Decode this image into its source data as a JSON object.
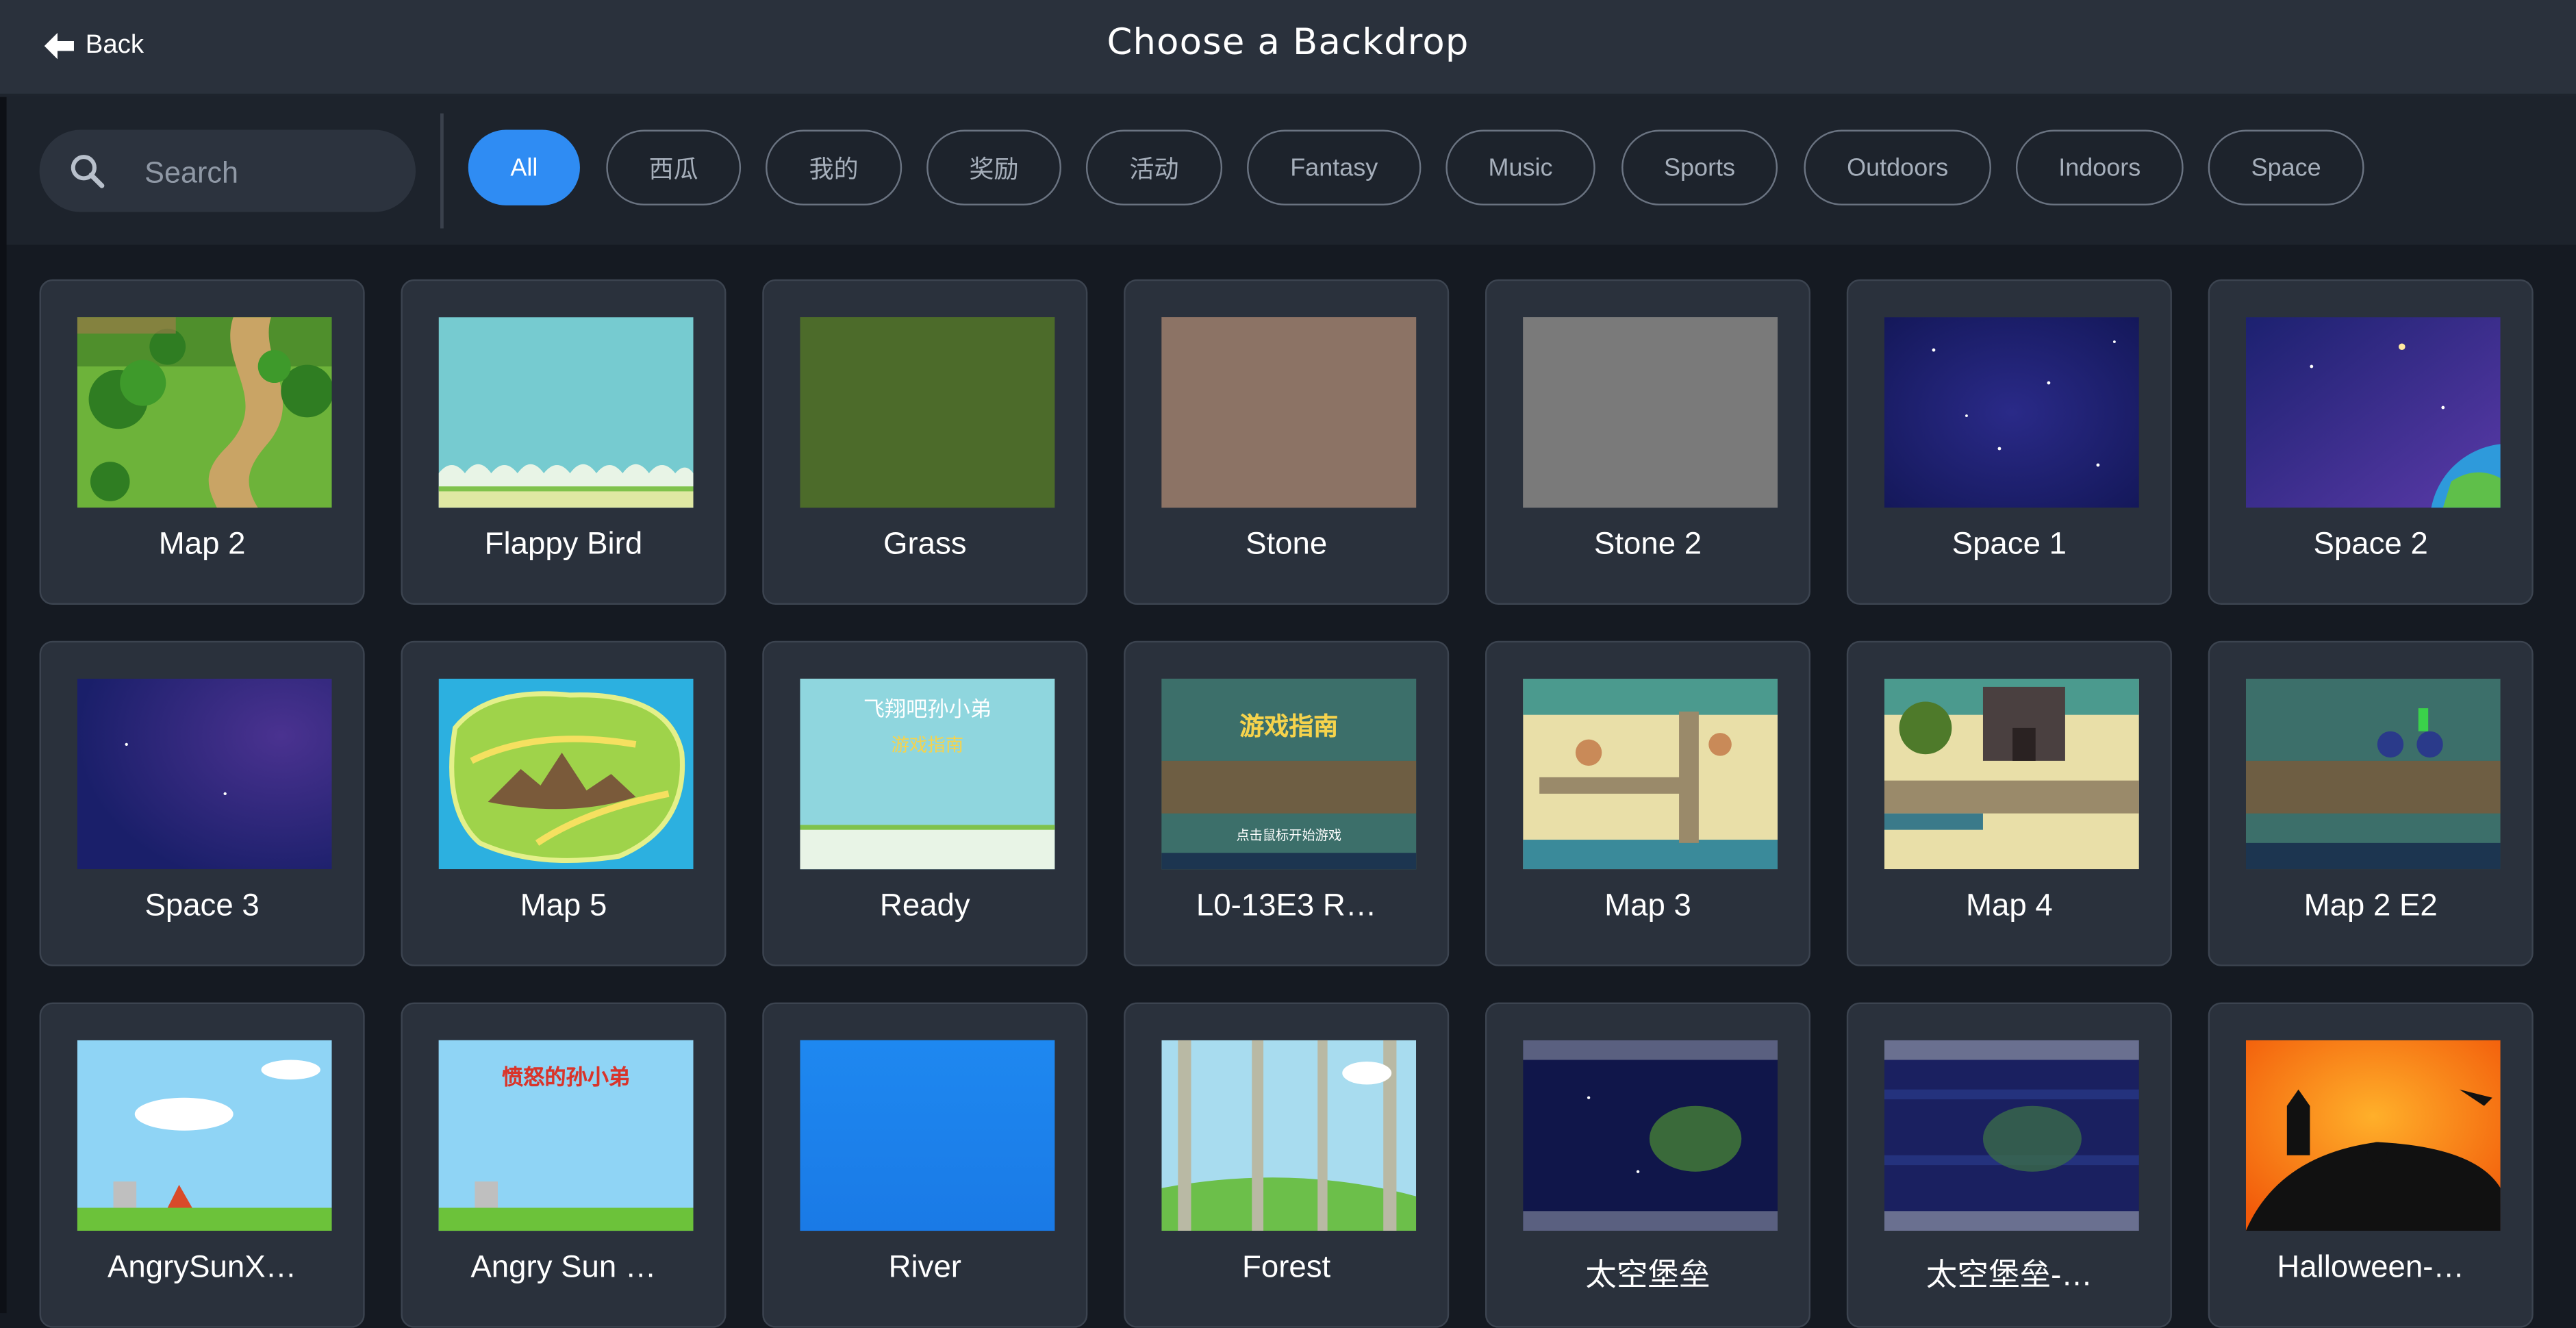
{
  "header": {
    "back_label": "Back",
    "title": "Choose a Backdrop"
  },
  "search": {
    "placeholder": "Search"
  },
  "tags": [
    "All",
    "西瓜",
    "我的",
    "奖励",
    "活动",
    "Fantasy",
    "Music",
    "Sports",
    "Outdoors",
    "Indoors",
    "Space"
  ],
  "active_tag": "All",
  "backdrops": [
    {
      "name": "Map 2"
    },
    {
      "name": "Flappy Bird"
    },
    {
      "name": "Grass"
    },
    {
      "name": "Stone"
    },
    {
      "name": "Stone 2"
    },
    {
      "name": "Space 1"
    },
    {
      "name": "Space 2"
    },
    {
      "name": "Space 3"
    },
    {
      "name": "Map 5"
    },
    {
      "name": "Ready",
      "thumb_title": "飞翔吧孙小弟",
      "thumb_subtitle": "游戏指南"
    },
    {
      "name": "L0-13E3 R…",
      "thumb_title": "游戏指南",
      "thumb_footer": "点击鼠标开始游戏"
    },
    {
      "name": "Map 3"
    },
    {
      "name": "Map 4"
    },
    {
      "name": "Map 2 E2"
    },
    {
      "name": "AngrySunX…"
    },
    {
      "name": "Angry Sun …",
      "thumb_title": "愤怒的孙小弟"
    },
    {
      "name": "River"
    },
    {
      "name": "Forest"
    },
    {
      "name": "太空堡垒"
    },
    {
      "name": "太空堡垒-…"
    },
    {
      "name": "Halloween-…"
    }
  ],
  "colors": {
    "accent": "#2f8cf3",
    "header_bg": "#2a313c",
    "card_bg": "#2a313c",
    "page_bg": "#151a22"
  }
}
